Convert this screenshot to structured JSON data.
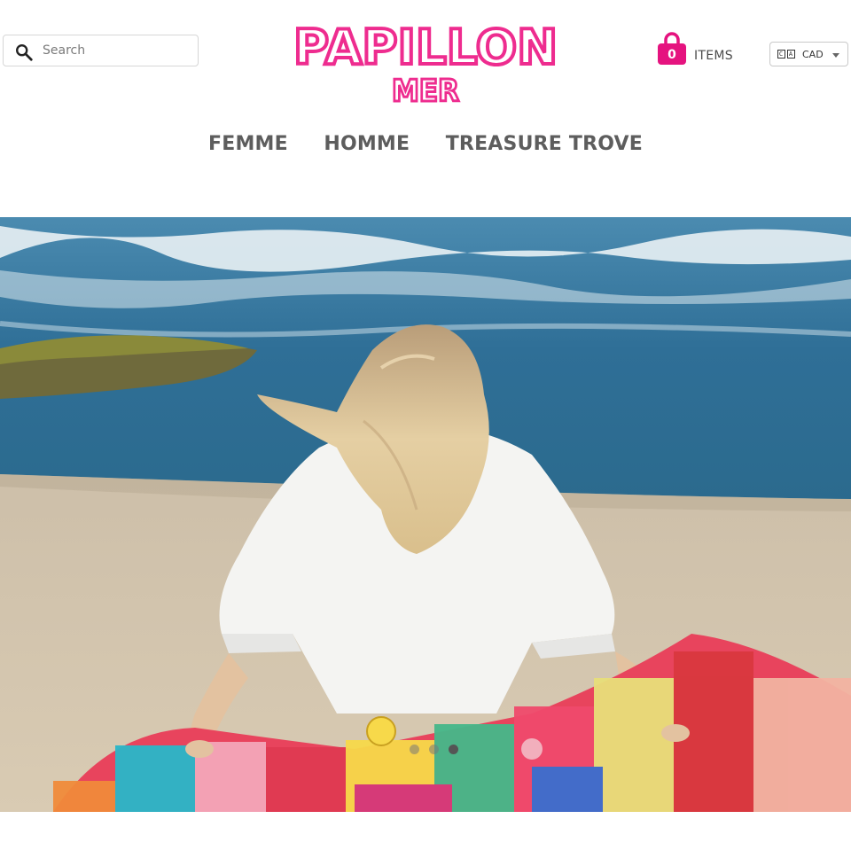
{
  "search": {
    "placeholder": "Search"
  },
  "logo": {
    "line1": "PAPILLON",
    "line2": "MER",
    "color": "#ee2c8f"
  },
  "cart": {
    "count": "0",
    "label": "ITEMS",
    "color": "#e5137f"
  },
  "currency": {
    "flag": "CA",
    "code": "CAD"
  },
  "nav": {
    "items": [
      "FEMME",
      "HOMME",
      "TREASURE TROVE"
    ]
  },
  "hero": {
    "image": "woman-on-beach-with-patchwork-quilt",
    "slides": 3,
    "active_slide": 3
  }
}
